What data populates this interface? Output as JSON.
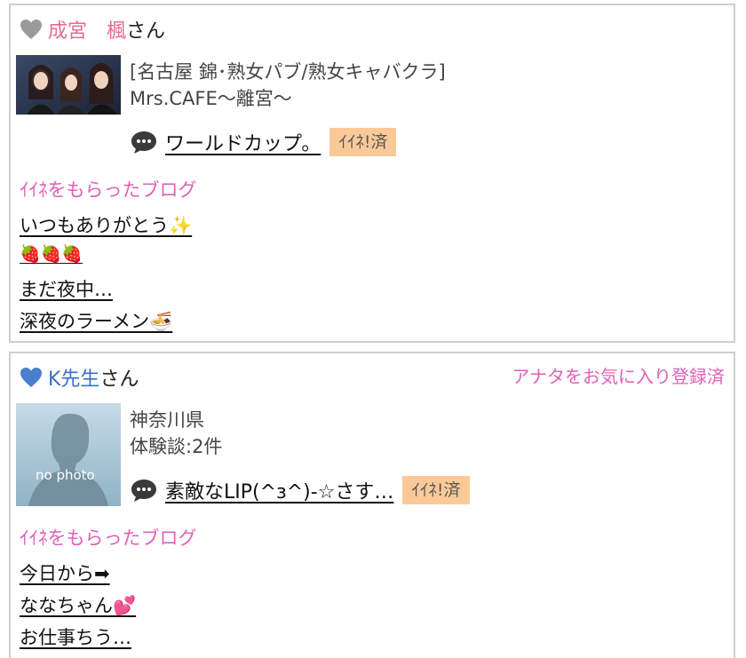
{
  "cards": [
    {
      "user_name": "成宮　楓",
      "honorific": "さん",
      "heart_color": "#9a9a9a",
      "name_color": "#e86a8f",
      "shop_line1": "[名古屋 錦･熟女パブ/熟女キャバクラ]",
      "shop_line2": "Mrs.CAFE～離宮～",
      "latest_post": "ワールドカップ。",
      "iine_badge": "ｲｲﾈ!済",
      "blog_header": "ｲｲﾈをもらったブログ",
      "blogs": [
        "いつもありがとう✨",
        "🍓🍓🍓",
        "まだ夜中…",
        "深夜のラーメン🍜"
      ]
    },
    {
      "user_name": "K先生",
      "honorific": "さん",
      "heart_color": "#4a7fd0",
      "name_color": "#3b6fc8",
      "favorite_label": "アナタをお気に入り登録済",
      "shop_line1": "神奈川県",
      "shop_line2": "体験談:2件",
      "photo_label": "no photo",
      "latest_post": "素敵なLIP(^з^)-☆さす…",
      "iine_badge": "ｲｲﾈ!済",
      "blog_header": "ｲｲﾈをもらったブログ",
      "blogs": [
        "今日から➡",
        "ななちゃん💕",
        "お仕事ちう…"
      ]
    }
  ]
}
